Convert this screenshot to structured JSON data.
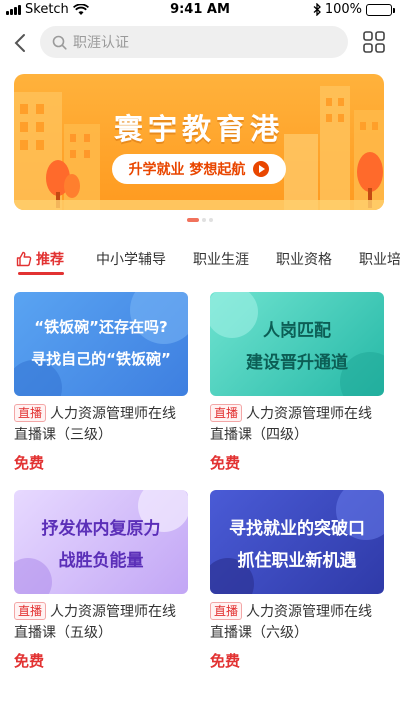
{
  "status_bar": {
    "carrier": "Sketch",
    "time": "9:41 AM",
    "battery": "100%"
  },
  "search": {
    "placeholder": "职涯认证"
  },
  "banner": {
    "title": "寰宇教育港",
    "subtitle": "升学就业 梦想起航"
  },
  "tabs": [
    {
      "label": "推荐",
      "active": true
    },
    {
      "label": "中小学辅导"
    },
    {
      "label": "职业生涯"
    },
    {
      "label": "职业资格"
    },
    {
      "label": "职业培"
    }
  ],
  "courses": [
    {
      "thumb_lines": [
        "“铁饭碗”还存在吗?",
        "寻找自己的“铁饭碗”"
      ],
      "badge": "直播",
      "title": "人力资源管理师在线直播课（三级）",
      "price": "免费"
    },
    {
      "thumb_lines": [
        "人岗匹配",
        "建设晋升通道"
      ],
      "badge": "直播",
      "title": "人力资源管理师在线直播课（四级）",
      "price": "免费"
    },
    {
      "thumb_lines": [
        "抒发体内复原力",
        "战胜负能量"
      ],
      "badge": "直播",
      "title": "人力资源管理师在线直播课（五级）",
      "price": "免费"
    },
    {
      "thumb_lines": [
        "寻找就业的突破口",
        "抓住职业新机遇"
      ],
      "badge": "直播",
      "title": "人力资源管理师在线直播课（六级）",
      "price": "免费"
    }
  ],
  "colors": {
    "accent": "#e23232",
    "banner": "#ff9a1f"
  }
}
